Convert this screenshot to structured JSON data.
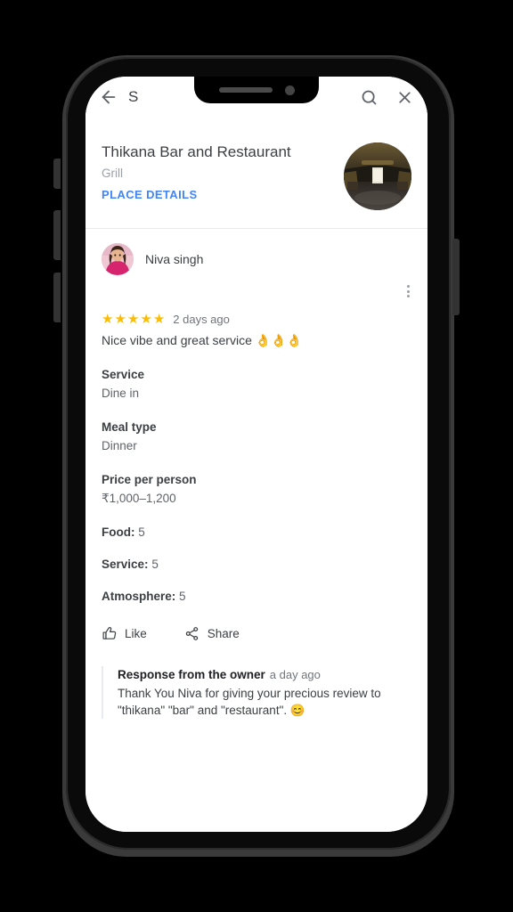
{
  "device": {
    "notch": {
      "speaker": "speaker-grille",
      "camera": "front-camera"
    },
    "buttons": [
      "silent-switch",
      "volume-up",
      "volume-down",
      "power"
    ]
  },
  "topbar": {
    "back_icon": "back-arrow-icon",
    "title": "S",
    "search_icon": "search-icon",
    "close_icon": "close-icon"
  },
  "place": {
    "title": "Thikana Bar and Restaurant",
    "category": "Grill",
    "details_link": "PLACE DETAILS",
    "thumbnail_alt": "restaurant-interior-photo",
    "link_color": "#4285f4"
  },
  "review": {
    "reviewer_name": "Niva singh",
    "avatar_alt": "reviewer-avatar-photo",
    "overflow_icon": "more-vertical-icon",
    "stars": 5,
    "star_glyph": "★",
    "star_color": "#fbbc04",
    "date": "2 days ago",
    "text": "Nice vibe and great service 👌👌👌",
    "attributes": [
      {
        "label": "Service",
        "value": "Dine in"
      },
      {
        "label": "Meal type",
        "value": "Dinner"
      },
      {
        "label": "Price per person",
        "value": "₹1,000–1,200"
      }
    ],
    "scores": [
      {
        "label": "Food:",
        "value": "5"
      },
      {
        "label": "Service:",
        "value": "5"
      },
      {
        "label": "Atmosphere:",
        "value": "5"
      }
    ],
    "actions": [
      {
        "label": "Like",
        "icon": "thumbs-up-icon"
      },
      {
        "label": "Share",
        "icon": "share-icon"
      }
    ]
  },
  "owner_response": {
    "heading": "Response from the owner",
    "date": "a day ago",
    "body": "Thank You Niva for giving your precious review to \"thikana\" \"bar\" and \"restaurant\". 😊"
  }
}
